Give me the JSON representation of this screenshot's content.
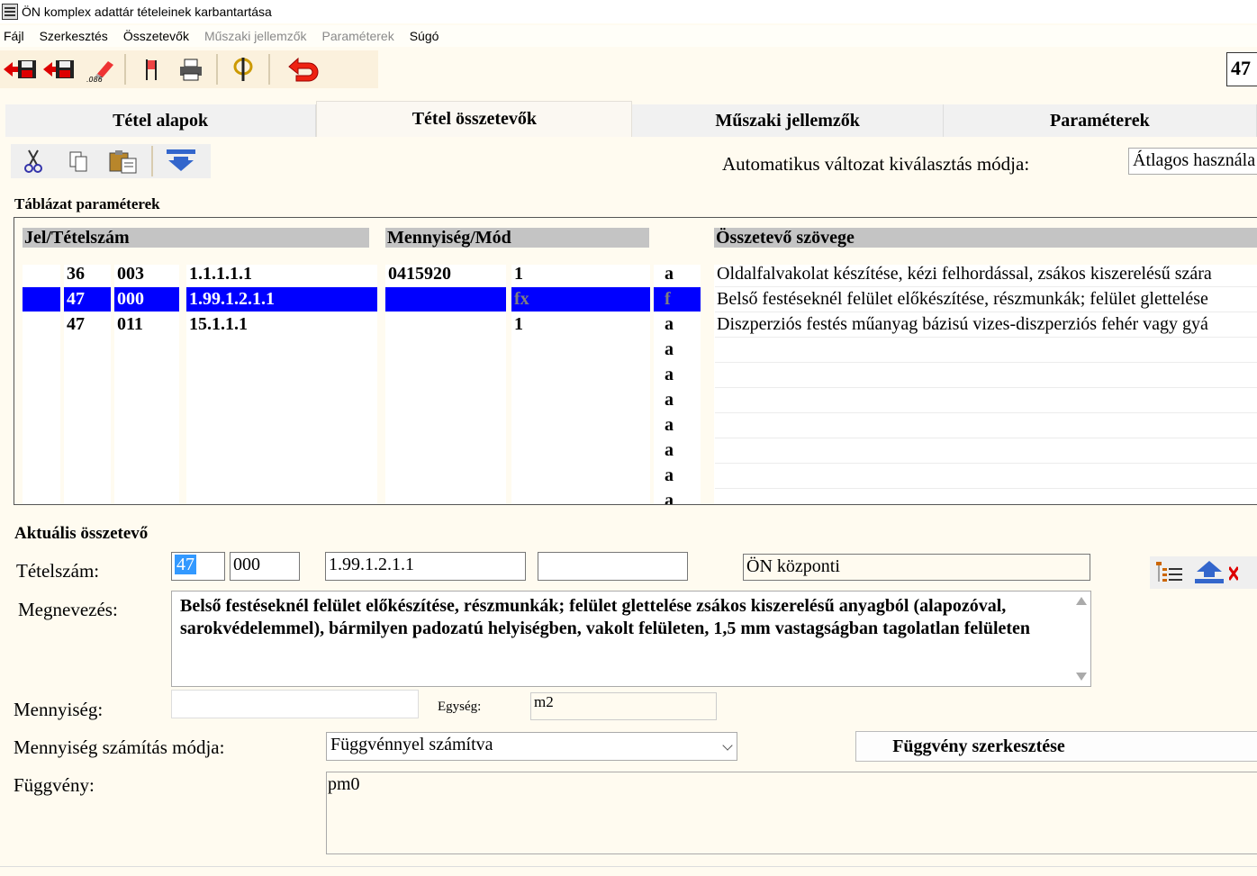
{
  "window": {
    "title": "ÖN komplex adattár tételeinek karbantartása"
  },
  "menu": {
    "items": [
      {
        "label": "Fájl",
        "enabled": true
      },
      {
        "label": "Szerkesztés",
        "enabled": true
      },
      {
        "label": "Összetevők",
        "enabled": true
      },
      {
        "label": "Műszaki jellemzők",
        "enabled": false
      },
      {
        "label": "Paraméterek",
        "enabled": false
      },
      {
        "label": "Súgó",
        "enabled": true
      }
    ]
  },
  "toolbar": {
    "icons": [
      "save-exit-icon",
      "save-back-icon",
      "eraser-icon",
      "flag-icon",
      "printer-icon",
      "phi-icon",
      "undo-icon"
    ],
    "record_number": "47"
  },
  "tabs": [
    {
      "label": "Tétel alapok",
      "active": false
    },
    {
      "label": "Tétel összetevők",
      "active": true
    },
    {
      "label": "Műszaki jellemzők",
      "active": false
    },
    {
      "label": "Paraméterek",
      "active": false
    }
  ],
  "subtoolbar": {
    "icons": [
      "scissors-icon",
      "copy-icon",
      "paste-icon",
      "insert-down-icon"
    ],
    "auto_label": "Automatikus változat kiválasztás módja:",
    "auto_value": "Átlagos használa"
  },
  "grid": {
    "group_label": "Táblázat paraméterek",
    "headers": {
      "id": "Jel/Tételszám",
      "qty": "Mennyiség/Mód",
      "text": "Összetevő szövege"
    },
    "rows": [
      {
        "jel": "36",
        "c2": "003",
        "tetel": "1.1.1.1.1",
        "menny": "0415920",
        "mod": "1",
        "flag": "a",
        "szoveg": "Oldalfalvakolat készítése, kézi felhordással, zsákos kiszerelésű szára",
        "selected": false
      },
      {
        "jel": "47",
        "c2": "000",
        "tetel": "1.99.1.2.1.1",
        "menny": "",
        "mod": "fx",
        "flag": "f",
        "szoveg": "Belső festéseknél felület előkészítése, részmunkák; felület glettelése",
        "selected": true
      },
      {
        "jel": "47",
        "c2": "011",
        "tetel": "15.1.1.1",
        "menny": "",
        "mod": "1",
        "flag": "a",
        "szoveg": "Diszperziós festés műanyag bázisú vizes-diszperziós  fehér vagy gyá",
        "selected": false
      }
    ],
    "empty_flags": [
      "a",
      "a",
      "a",
      "a",
      "a",
      "a",
      "a"
    ]
  },
  "current": {
    "group_label": "Aktuális összetevő",
    "tetelszam_label": "Tételszám:",
    "tetel_part1": "47",
    "tetel_part2": "000",
    "tetel_part3": "1.99.1.2.1.1",
    "tetel_part4": "",
    "source": "ÖN központi",
    "nev_label": "Megnevezés:",
    "nev_value": "Belső festéseknél felület előkészítése, részmunkák; felület glettelése zsákos kiszerelésű anyagból (alapozóval, sarokvédelemmel), bármilyen padozatú helyiségben, vakolt felületen, 1,5 mm vastagságban tagolatlan felületen",
    "menny_label": "Mennyiség:",
    "menny_value": "",
    "egyseg_label": "Egység:",
    "egyseg_value": "m2",
    "mod_label": "Mennyiség számítás módja:",
    "mod_value": "Függvénnyel számítva",
    "func_button": "Függvény szerkesztése",
    "func_label": "Függvény:",
    "func_value": "pm0",
    "right_icons": [
      "tree-list-icon",
      "move-up-icon",
      "delete-icon"
    ]
  }
}
